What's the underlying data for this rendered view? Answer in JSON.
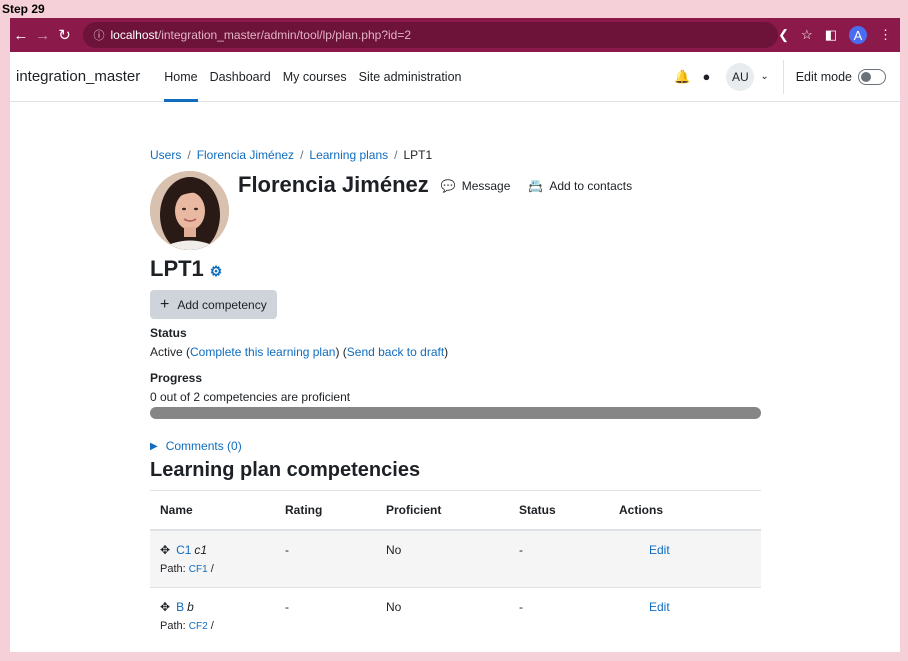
{
  "step_label": "Step 29",
  "browser": {
    "url_host": "localhost",
    "url_path": "/integration_master/admin/tool/lp/plan.php?id=2",
    "profile_initial": "A"
  },
  "topnav": {
    "site_name": "integration_master",
    "links": [
      "Home",
      "Dashboard",
      "My courses",
      "Site administration"
    ],
    "user_initials": "AU",
    "edit_mode_label": "Edit mode"
  },
  "breadcrumb": {
    "items": [
      "Users",
      "Florencia Jiménez",
      "Learning plans"
    ],
    "current": "LPT1"
  },
  "profile": {
    "name": "Florencia Jiménez",
    "message_label": "Message",
    "add_contact_label": "Add to contacts"
  },
  "plan": {
    "title": "LPT1",
    "add_competency_label": "Add competency",
    "status_label": "Status",
    "status_text": "Active (",
    "complete_link": "Complete this learning plan",
    "mid_text": ") (",
    "send_back_link": "Send back to draft",
    "end_text": ")",
    "progress_label": "Progress",
    "progress_text": "0 out of 2 competencies are proficient",
    "progress_fraction": 0.0,
    "comments_label": "Comments (0)",
    "competencies_title": "Learning plan competencies"
  },
  "table": {
    "headers": [
      "Name",
      "Rating",
      "Proficient",
      "Status",
      "Actions"
    ],
    "rows": [
      {
        "code": "C1",
        "desc": "c1",
        "path_label": "Path:",
        "path_link": "CF1",
        "path_sep": "/",
        "rating": "-",
        "proficient": "No",
        "status": "-",
        "action": "Edit"
      },
      {
        "code": "B",
        "desc": "b",
        "path_label": "Path:",
        "path_link": "CF2",
        "path_sep": "/",
        "rating": "-",
        "proficient": "No",
        "status": "-",
        "action": "Edit"
      }
    ]
  }
}
